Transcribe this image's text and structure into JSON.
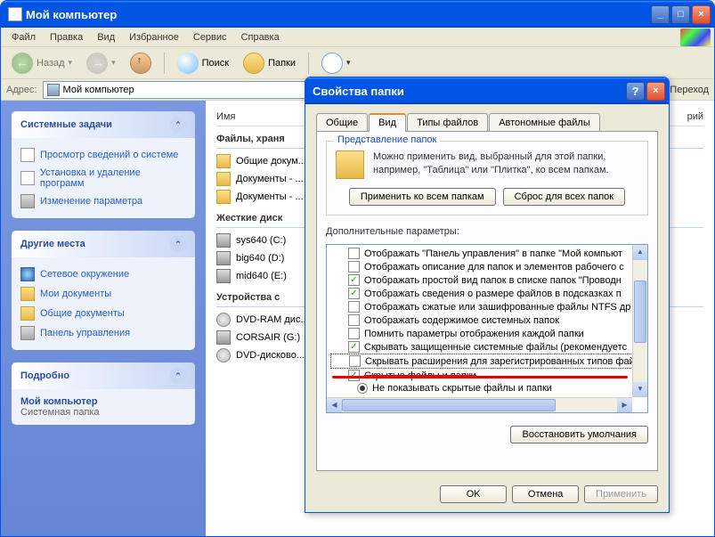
{
  "explorer": {
    "title": "Мой компьютер",
    "menu": [
      "Файл",
      "Правка",
      "Вид",
      "Избранное",
      "Сервис",
      "Справка"
    ],
    "toolbar": {
      "back": "Назад",
      "search": "Поиск",
      "folders": "Папки"
    },
    "address": {
      "label": "Адрес:",
      "value": "Мой компьютер",
      "go": "Переход"
    },
    "columns": {
      "name": "Имя",
      "other": "рий"
    },
    "sidebar": {
      "tasks": {
        "title": "Системные задачи",
        "items": [
          "Просмотр сведений о системе",
          "Установка и удаление программ",
          "Изменение параметра"
        ]
      },
      "places": {
        "title": "Другие места",
        "items": [
          "Сетевое окружение",
          "Мои документы",
          "Общие документы",
          "Панель управления"
        ]
      },
      "details": {
        "title": "Подробно",
        "name": "Мой компьютер",
        "type": "Системная папка"
      }
    },
    "groups": {
      "g1": {
        "title": "Файлы, храня",
        "items": [
          "Общие докум...",
          "Документы - ...",
          "Документы - ..."
        ]
      },
      "g2": {
        "title": "Жесткие диск",
        "items": [
          "sys640 (C:)",
          "big640 (D:)",
          "mid640 (E:)"
        ]
      },
      "g3": {
        "title": "Устройства с",
        "items": [
          "DVD-RAM дис...",
          "CORSAIR (G:)",
          "DVD-дисково..."
        ]
      }
    }
  },
  "dialog": {
    "title": "Свойства папки",
    "tabs": [
      "Общие",
      "Вид",
      "Типы файлов",
      "Автономные файлы"
    ],
    "activeTab": 1,
    "folderViews": {
      "title": "Представление папок",
      "text": "Можно применить вид, выбранный для этой папки, например, \"Таблица\" или \"Плитка\", ко всем папкам.",
      "applyAll": "Применить ко всем папкам",
      "resetAll": "Сброс для всех папок"
    },
    "advanced": {
      "label": "Дополнительные параметры:",
      "items": [
        {
          "type": "chk",
          "checked": false,
          "label": "Отображать \"Панель управления\" в папке \"Мой компьют"
        },
        {
          "type": "chk",
          "checked": false,
          "label": "Отображать описание для папок и элементов рабочего с"
        },
        {
          "type": "chk",
          "checked": true,
          "label": "Отображать простой вид папок в списке папок \"Проводн"
        },
        {
          "type": "chk",
          "checked": true,
          "label": "Отображать сведения о размере файлов в подсказках п"
        },
        {
          "type": "chk",
          "checked": false,
          "label": "Отображать сжатые или зашифрованные файлы NTFS др"
        },
        {
          "type": "chk",
          "checked": false,
          "label": "Отображать содержимое системных папок"
        },
        {
          "type": "chk",
          "checked": false,
          "label": "Помнить параметры отображения каждой папки"
        },
        {
          "type": "chk",
          "checked": true,
          "label": "Скрывать защищенные системные файлы (рекомендуетс"
        },
        {
          "type": "chk",
          "checked": false,
          "label": "Скрывать расширения для зарегистрированных типов файлов",
          "hl": true
        },
        {
          "type": "chk",
          "checked": true,
          "label": "Скрытые файлы и папки",
          "strike": true
        },
        {
          "type": "rdo",
          "checked": true,
          "label": "Не показывать скрытые файлы и папки"
        }
      ],
      "restore": "Восстановить умолчания"
    },
    "actions": {
      "ok": "OK",
      "cancel": "Отмена",
      "apply": "Применить"
    }
  }
}
